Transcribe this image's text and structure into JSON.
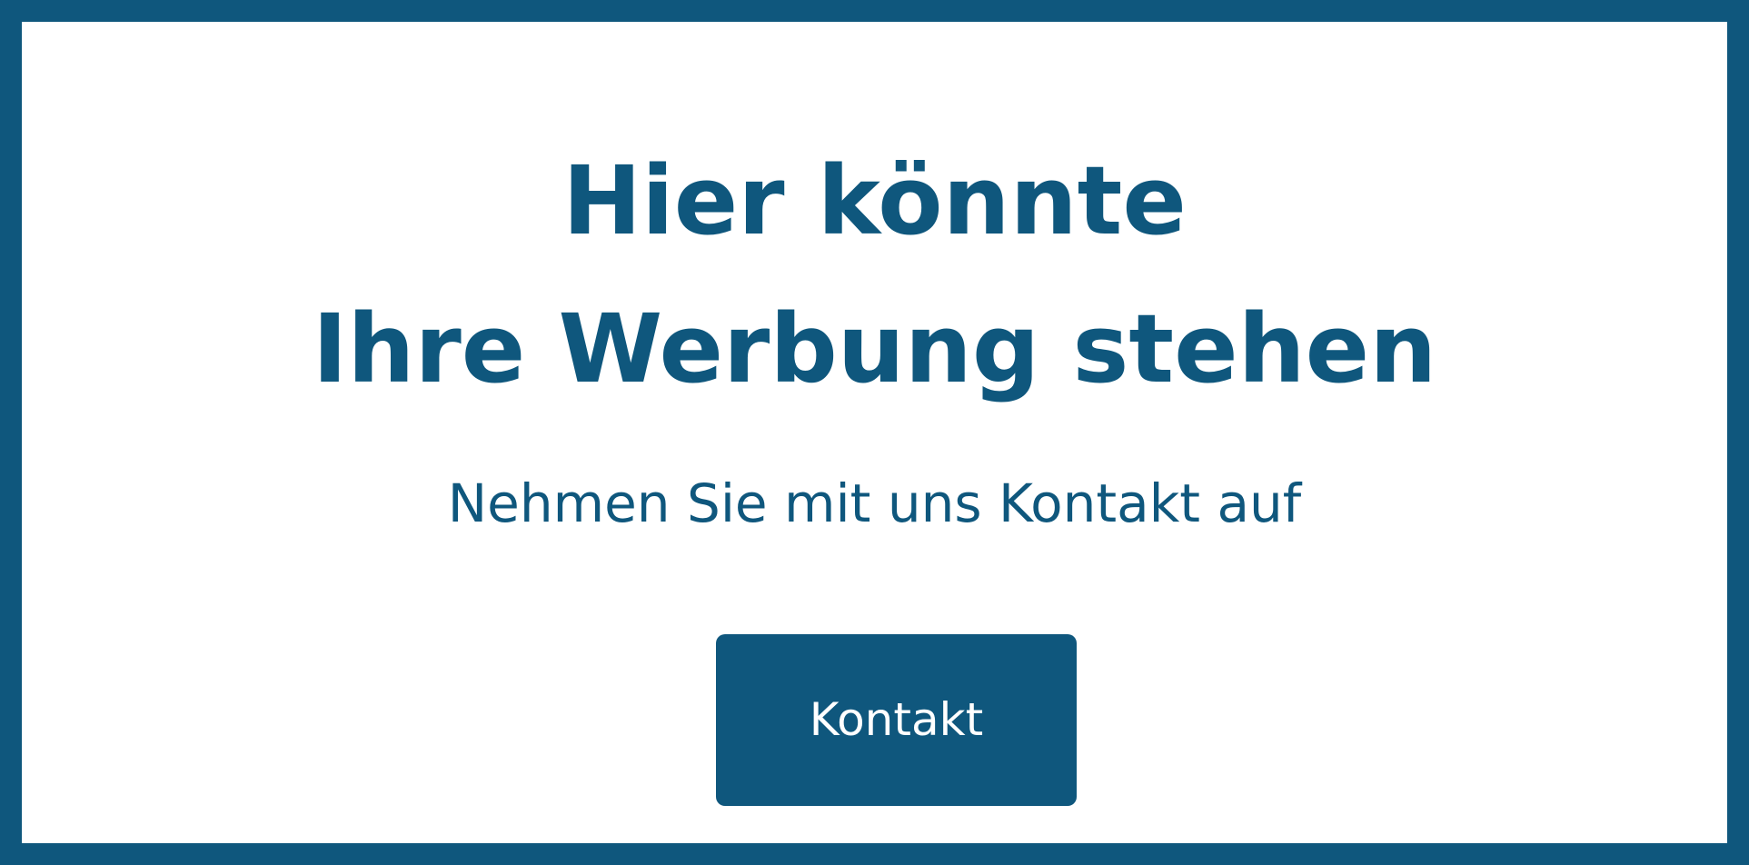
{
  "headline": {
    "line_1": "Hier könnte",
    "line_2": "Ihre Werbung stehen"
  },
  "subline": "Nehmen Sie mit uns Kontakt auf",
  "cta": {
    "label": "Kontakt"
  },
  "colors": {
    "brand": "#0f577d",
    "background": "#ffffff",
    "button_text": "#ffffff"
  }
}
